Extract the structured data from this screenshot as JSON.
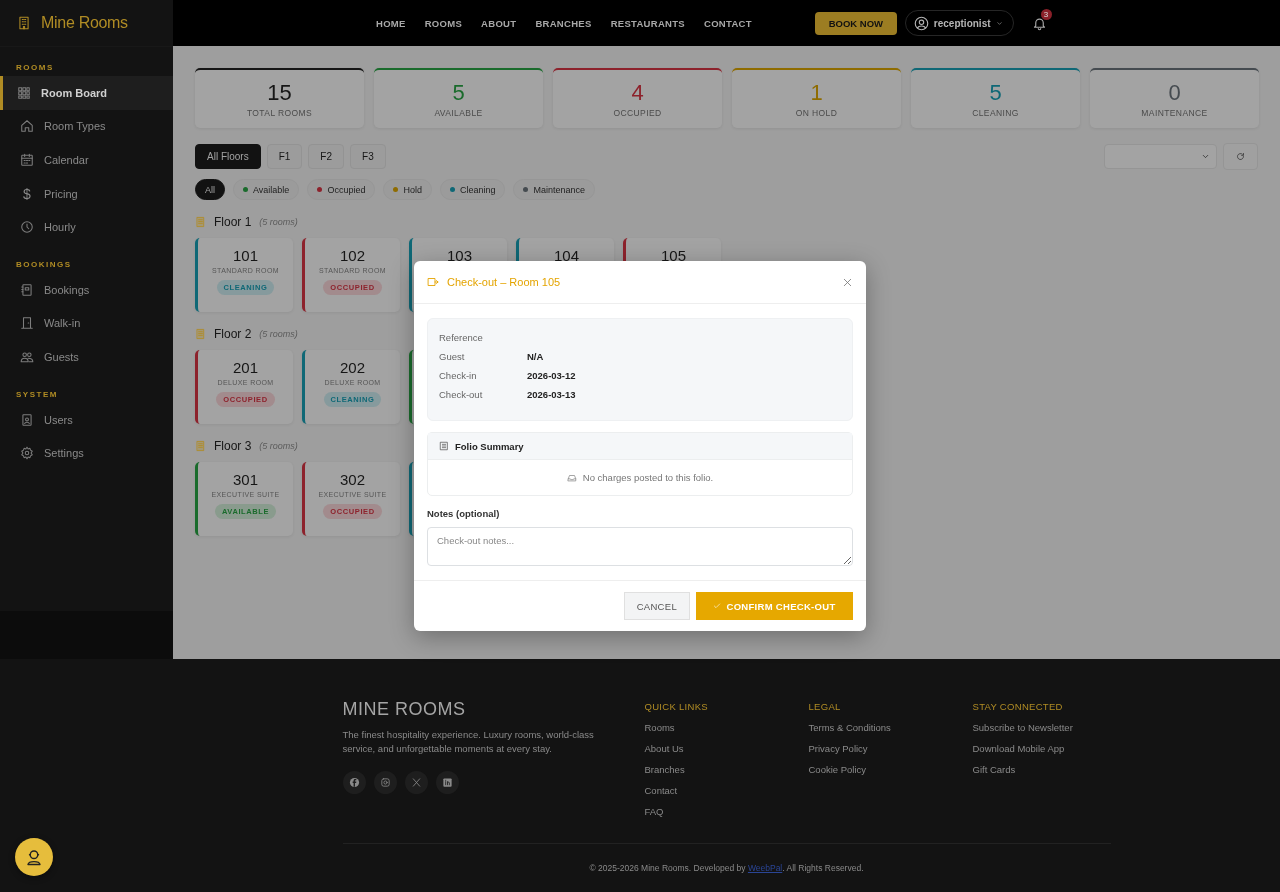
{
  "brand": {
    "name": "Mine Rooms"
  },
  "nav": [
    "HOME",
    "ROOMS",
    "ABOUT",
    "BRANCHES",
    "RESTAURANTS",
    "CONTACT"
  ],
  "book_button": "BOOK NOW",
  "user": {
    "name": "receptionist"
  },
  "notifications": {
    "count": "3"
  },
  "sidebar": [
    {
      "title": "ROOMS",
      "items": [
        {
          "label": "Room Board",
          "selected": true
        },
        {
          "label": "Room Types",
          "selected": false
        },
        {
          "label": "Calendar",
          "selected": false
        },
        {
          "label": "Pricing",
          "glyph": "$",
          "selected": false
        },
        {
          "label": "Hourly",
          "selected": false
        }
      ]
    },
    {
      "title": "BOOKINGS",
      "items": [
        {
          "label": "Bookings",
          "selected": false
        },
        {
          "label": "Walk-in",
          "selected": false
        },
        {
          "label": "Guests",
          "selected": false
        }
      ]
    },
    {
      "title": "SYSTEM",
      "items": [
        {
          "label": "Users",
          "selected": false
        },
        {
          "label": "Settings",
          "selected": false
        }
      ]
    }
  ],
  "stats": [
    {
      "value": "15",
      "label": "TOTAL ROOMS",
      "color": "#161616"
    },
    {
      "value": "5",
      "label": "AVAILABLE",
      "color": "#1a6b2c"
    },
    {
      "value": "4",
      "label": "OCCUPIED",
      "color": "#8d222c"
    },
    {
      "value": "1",
      "label": "ON HOLD",
      "color": "#8f6c00"
    },
    {
      "value": "5",
      "label": "CLEANING",
      "color": "#0f6876"
    },
    {
      "value": "0",
      "label": "MAINTENANCE",
      "color": "#454b50"
    }
  ],
  "floor_tabs": [
    {
      "label": "All Floors",
      "selected": true
    },
    {
      "label": "F1",
      "selected": false
    },
    {
      "label": "F2",
      "selected": false
    },
    {
      "label": "F3",
      "selected": false
    }
  ],
  "status_filters": [
    {
      "label": "All",
      "selected": true
    },
    {
      "label": "Available",
      "color": "#1a6b2c",
      "selected": false
    },
    {
      "label": "Occupied",
      "color": "#8d222c",
      "selected": false
    },
    {
      "label": "Hold",
      "color": "#8f6c00",
      "selected": false
    },
    {
      "label": "Cleaning",
      "color": "#0f6876",
      "selected": false
    },
    {
      "label": "Maintenance",
      "color": "#454b50",
      "selected": false
    }
  ],
  "floors": [
    {
      "title": "Floor 1",
      "count": "(5 rooms)",
      "rooms": [
        {
          "number": "101",
          "type": "STANDARD ROOM",
          "status": "CLEANING",
          "color": "#0f6876"
        },
        {
          "number": "102",
          "type": "STANDARD ROOM",
          "status": "OCCUPIED",
          "color": "#8d222c"
        },
        {
          "number": "103",
          "color": "#0f6876"
        },
        {
          "number": "104",
          "color": "#0f6876"
        },
        {
          "number": "105",
          "color": "#8d222c"
        }
      ]
    },
    {
      "title": "Floor 2",
      "count": "(5 rooms)",
      "rooms": [
        {
          "number": "201",
          "type": "DELUXE ROOM",
          "status": "OCCUPIED",
          "color": "#8d222c"
        },
        {
          "number": "202",
          "type": "DELUXE ROOM",
          "status": "CLEANING",
          "color": "#0f6876"
        },
        {
          "color": "#1a6b2c"
        }
      ]
    },
    {
      "title": "Floor 3",
      "count": "(5 rooms)",
      "rooms": [
        {
          "number": "301",
          "type": "EXECUTIVE SUITE",
          "status": "AVAILABLE",
          "color": "#1a6b2c"
        },
        {
          "number": "302",
          "type": "EXECUTIVE SUITE",
          "status": "OCCUPIED",
          "color": "#8d222c"
        },
        {
          "color": "#0f6876"
        }
      ]
    }
  ],
  "modal": {
    "title": "Check-out – Room 105",
    "details": [
      {
        "label": "Reference"
      },
      {
        "label": "Guest",
        "value": "N/A"
      },
      {
        "label": "Check-in",
        "value": "2026-03-12"
      },
      {
        "label": "Check-out",
        "value": "2026-03-13"
      }
    ],
    "folio": {
      "title": "Folio Summary",
      "empty": "No charges posted to this folio."
    },
    "notes": {
      "label": "Notes (optional)",
      "placeholder": "Check-out notes..."
    },
    "buttons": [
      {
        "label": "CANCEL",
        "kind": "secondary"
      },
      {
        "label": "CONFIRM CHECK-OUT",
        "kind": "primary"
      }
    ]
  },
  "footer": {
    "brand": "MINE ROOMS",
    "description": "The finest hospitality experience. Luxury rooms, world-class service, and unforgettable moments at every stay.",
    "columns": [
      {
        "title": "QUICK LINKS",
        "links": [
          "Rooms",
          "About Us",
          "Branches",
          "Contact",
          "FAQ"
        ]
      },
      {
        "title": "LEGAL",
        "links": [
          "Terms & Conditions",
          "Privacy Policy",
          "Cookie Policy"
        ]
      },
      {
        "title": "STAY CONNECTED",
        "links": [
          "Subscribe to Newsletter",
          "Download Mobile App",
          "Gift Cards"
        ]
      }
    ],
    "copyright": {
      "before": "© 2025-2026 Mine Rooms. Developed by ",
      "link": "WeebPal",
      "after": ". All Rights Reserved."
    }
  }
}
